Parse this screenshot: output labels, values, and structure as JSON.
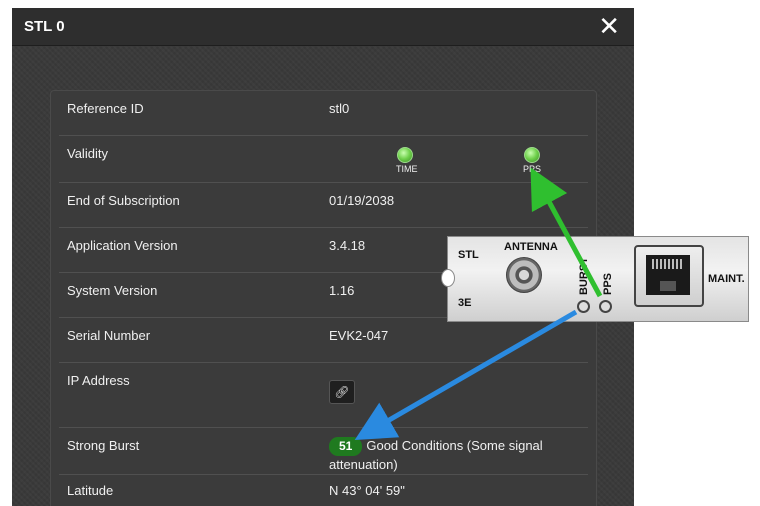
{
  "dialog": {
    "title": "STL 0",
    "close_label": "✕"
  },
  "rows": {
    "reference_id": {
      "label": "Reference ID",
      "value": "stl0"
    },
    "validity": {
      "label": "Validity",
      "time_label": "TIME",
      "pps_label": "PPS"
    },
    "end_of_subscription": {
      "label": "End of Subscription",
      "value": "01/19/2038"
    },
    "application_version": {
      "label": "Application Version",
      "value": "3.4.18"
    },
    "system_version": {
      "label": "System Version",
      "value": "1.16"
    },
    "serial_number": {
      "label": "Serial Number",
      "value": "EVK2-047"
    },
    "ip_address": {
      "label": "IP Address",
      "button_icon": "link-icon"
    },
    "strong_burst": {
      "label": "Strong Burst",
      "badge": "51",
      "status_text": "Good Conditions (Some signal attenuation)"
    },
    "latitude": {
      "label": "Latitude",
      "value": "N 43° 04' 59\""
    }
  },
  "card": {
    "stl": "STL",
    "model": "3E",
    "antenna": "ANTENNA",
    "burst": "BURST",
    "pps": "PPS",
    "maint": "MAINT."
  },
  "colors": {
    "led_green": "#6ed04a",
    "badge_green": "#1f7a1f",
    "arrow_green": "#2fbf2f",
    "arrow_blue": "#2a8ae0"
  }
}
